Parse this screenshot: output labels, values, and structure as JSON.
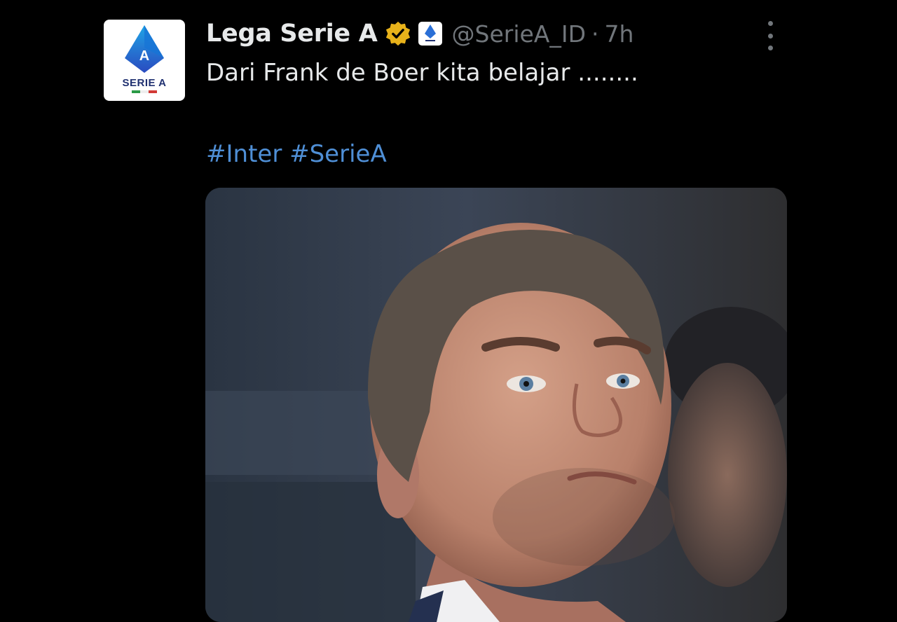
{
  "tweet": {
    "display_name": "Lega Serie A",
    "handle": "@SerieA_ID",
    "separator": "·",
    "time": "7h",
    "text": "Dari Frank de Boer kita belajar ........",
    "hashtags": [
      "#Inter",
      "#SerieA"
    ],
    "avatar_label": "SERIE A",
    "verified_badge_color": "#e8b21a",
    "hashtag_color": "#4f8fd6",
    "icons": {
      "verified": "verified-badge-icon",
      "affiliate": "serie-a-affiliate-icon",
      "more": "more-options-icon",
      "avatar_logo": "serie-a-logo-icon"
    }
  }
}
